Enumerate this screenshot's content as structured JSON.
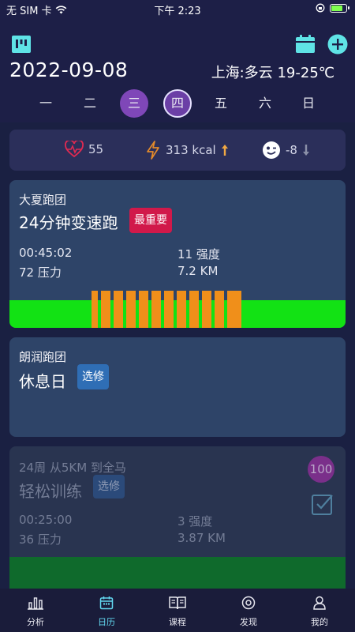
{
  "status": {
    "carrier": "无 SIM 卡",
    "time": "下午 2:23",
    "battery_level": 0.8
  },
  "header": {
    "date": "2022-09-08",
    "weather": "上海:多云 19-25℃",
    "icons": [
      "board-icon",
      "calendar-icon",
      "add-icon"
    ],
    "accent": "#5fe3e6"
  },
  "weekdays": [
    {
      "label": "一",
      "state": ""
    },
    {
      "label": "二",
      "state": ""
    },
    {
      "label": "三",
      "state": "today"
    },
    {
      "label": "四",
      "state": "selected"
    },
    {
      "label": "五",
      "state": ""
    },
    {
      "label": "六",
      "state": ""
    },
    {
      "label": "日",
      "state": ""
    }
  ],
  "stats": {
    "heart": "55",
    "calories": "313 kcal",
    "mood": "-8"
  },
  "cards": [
    {
      "club": "大夏跑团",
      "title": "24分钟变速跑",
      "badge": "最重要",
      "duration": "00:45:02",
      "intensity": "11 强度",
      "pressure": "72 压力",
      "distance": "7.2 KM"
    },
    {
      "club": "朗润跑团",
      "title": "休息日",
      "badge": "选修"
    },
    {
      "club": "24周 从5KM 到全马",
      "title": "轻松训练",
      "badge": "选修",
      "score": "100",
      "duration": "00:25:00",
      "intensity": "3 强度",
      "pressure": "36 压力",
      "distance": "3.87 KM"
    }
  ],
  "tabs": [
    {
      "label": "分析",
      "icon": "chart-icon",
      "active": false
    },
    {
      "label": "日历",
      "icon": "calendar-icon",
      "active": true
    },
    {
      "label": "课程",
      "icon": "book-icon",
      "active": false
    },
    {
      "label": "发现",
      "icon": "compass-icon",
      "active": false
    },
    {
      "label": "我的",
      "icon": "user-icon",
      "active": false
    }
  ]
}
